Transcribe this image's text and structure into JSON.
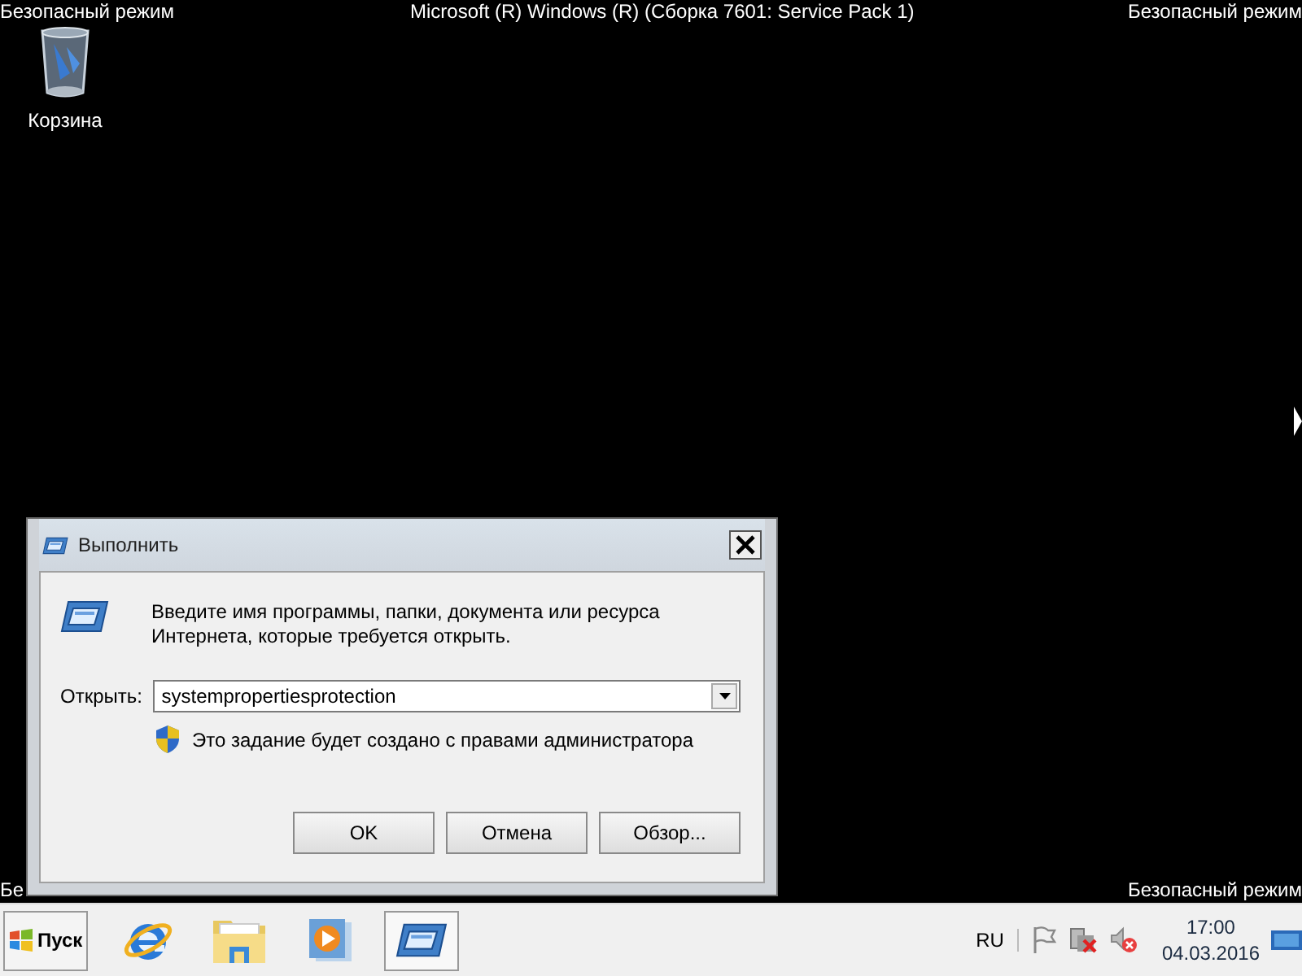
{
  "desktop_labels": {
    "top_left": "Безопасный режим",
    "top_center": "Microsoft (R) Windows (R) (Сборка 7601: Service Pack 1)",
    "top_right": "Безопасный режим",
    "bottom_left": "Бе",
    "bottom_right": "Безопасный режим"
  },
  "desktop_icons": [
    {
      "kind": "recycle_bin",
      "label": "Корзина"
    }
  ],
  "dialog": {
    "title": "Выполнить",
    "description": "Введите имя программы, папки, документа или ресурса Интернета, которые требуется открыть.",
    "open_label": "Открыть:",
    "open_value": "systempropertiesprotection",
    "admin_note": "Это задание будет создано с правами администратора",
    "buttons": [
      {
        "label": "OK"
      },
      {
        "label": "Отмена"
      },
      {
        "label": "Обзор..."
      }
    ]
  },
  "taskbar": {
    "start": "Пуск",
    "apps": [
      {
        "kind": "browser",
        "selected": false
      },
      {
        "kind": "folder",
        "selected": false
      },
      {
        "kind": "media",
        "selected": false
      },
      {
        "kind": "run",
        "selected": true
      }
    ],
    "language": "RU",
    "time": "17:00",
    "date": "04.03.2016"
  }
}
